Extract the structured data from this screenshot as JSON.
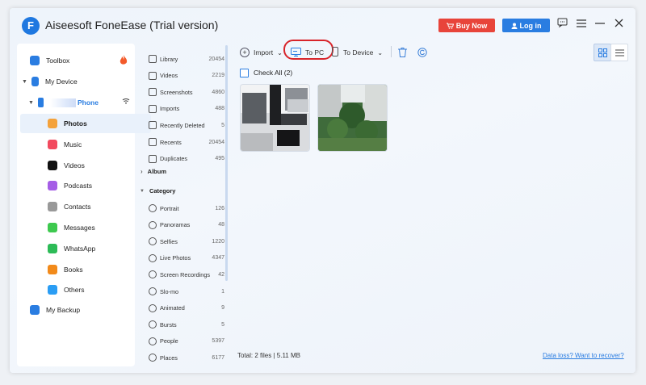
{
  "app": {
    "logo_letter": "F",
    "title": "Aiseesoft FoneEase (Trial version)",
    "buy_label": "Buy Now",
    "login_label": "Log in"
  },
  "sidebar": {
    "toolbox": "Toolbox",
    "my_device": "My Device",
    "device_name": "Phone",
    "items": [
      {
        "label": "Photos",
        "icon": "photos-icon",
        "color": "#f4a23b",
        "active": true
      },
      {
        "label": "Music",
        "icon": "music-icon",
        "color": "#f24a5e",
        "active": false
      },
      {
        "label": "Videos",
        "icon": "videos-icon",
        "color": "#111111",
        "active": false
      },
      {
        "label": "Podcasts",
        "icon": "podcasts-icon",
        "color": "#a55ee6",
        "active": false
      },
      {
        "label": "Contacts",
        "icon": "contacts-icon",
        "color": "#999999",
        "active": false
      },
      {
        "label": "Messages",
        "icon": "messages-icon",
        "color": "#3ec94f",
        "active": false
      },
      {
        "label": "WhatsApp",
        "icon": "whatsapp-icon",
        "color": "#2dbb57",
        "active": false
      },
      {
        "label": "Books",
        "icon": "books-icon",
        "color": "#f28a1a",
        "active": false
      },
      {
        "label": "Others",
        "icon": "others-icon",
        "color": "#2a9df4",
        "active": false
      }
    ],
    "my_backup": "My Backup"
  },
  "photo_list": {
    "items": [
      {
        "label": "Library",
        "count": "20454"
      },
      {
        "label": "Videos",
        "count": "2219"
      },
      {
        "label": "Screenshots",
        "count": "4860"
      },
      {
        "label": "Imports",
        "count": "488"
      },
      {
        "label": "Recently Deleted",
        "count": "5"
      },
      {
        "label": "Recents",
        "count": "20454"
      },
      {
        "label": "Duplicates",
        "count": "495"
      }
    ],
    "album_label": "Album",
    "category_label": "Category",
    "categories": [
      {
        "label": "Portrait",
        "count": "126"
      },
      {
        "label": "Panoramas",
        "count": "48"
      },
      {
        "label": "Selfies",
        "count": "1220"
      },
      {
        "label": "Live Photos",
        "count": "4347"
      },
      {
        "label": "Screen Recordings",
        "count": "42"
      },
      {
        "label": "Slo-mo",
        "count": "1"
      },
      {
        "label": "Animated",
        "count": "9"
      },
      {
        "label": "Bursts",
        "count": "5"
      },
      {
        "label": "People",
        "count": "5397"
      },
      {
        "label": "Places",
        "count": "6177"
      }
    ]
  },
  "toolbar": {
    "import_label": "Import",
    "to_pc_label": "To PC",
    "to_device_label": "To Device"
  },
  "content": {
    "check_all": "Check All (2)",
    "total": "Total: 2 files | 5.11 MB",
    "recover_link": "Data loss? Want to recover?"
  },
  "colors": {
    "accent": "#2a7de1",
    "buy": "#e8443a",
    "highlight": "#d8242a"
  }
}
